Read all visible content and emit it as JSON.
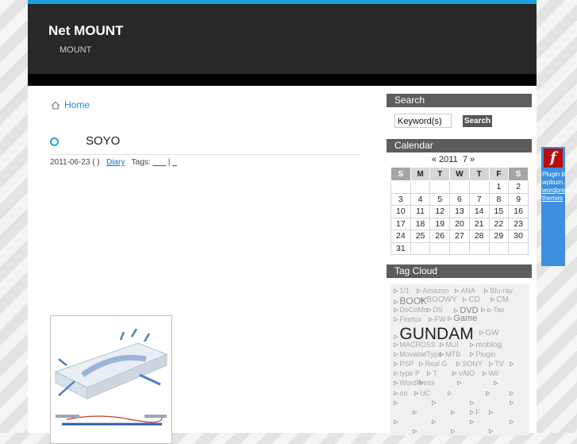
{
  "site": {
    "title": "Net MOUNT",
    "subtitle": "MOUNT"
  },
  "nav": {
    "home_label": "Home"
  },
  "post": {
    "title": "SOYO",
    "date": "2011-06-23 ( )",
    "category": "Diary",
    "tags_label": "Tags:",
    "tag1": "___",
    "tag_sep": " | ",
    "tag2": "_"
  },
  "search": {
    "heading": "Search",
    "value": "Keyword(s)",
    "button": "Search"
  },
  "calendar": {
    "heading": "Calendar",
    "prev": "«",
    "year": "2011",
    "month": "7",
    "next": "»",
    "weekdays": [
      "S",
      "M",
      "T",
      "W",
      "T",
      "F",
      "S"
    ],
    "weeks": [
      [
        "",
        "",
        "",
        "",
        "",
        "1",
        "2"
      ],
      [
        "3",
        "4",
        "5",
        "6",
        "7",
        "8",
        "9"
      ],
      [
        "10",
        "11",
        "12",
        "13",
        "14",
        "15",
        "16"
      ],
      [
        "17",
        "18",
        "19",
        "20",
        "21",
        "22",
        "23"
      ],
      [
        "24",
        "25",
        "26",
        "27",
        "28",
        "29",
        "30"
      ],
      [
        "31",
        "",
        "",
        "",
        "",
        "",
        ""
      ]
    ]
  },
  "tagcloud": {
    "heading": "Tag Cloud",
    "tags": [
      "1/1",
      "Amazon",
      "ANA",
      "Blu-ray",
      "BOOK",
      "BOOWY",
      "CD",
      "CM",
      "DoCoMo",
      "DS",
      "DVD",
      "e-Tax",
      "Firefox",
      "FW",
      "Game",
      "GUNDAM",
      "GW",
      "MACROSS",
      "MUI",
      "moblog",
      "MovableType",
      "MTB",
      "Plugin",
      "PSP",
      "Real G",
      "SONY",
      "TV",
      "type P",
      "T",
      "VAIO",
      "Wii",
      "WordPress",
      "oo",
      "UC",
      "F"
    ]
  },
  "flash": {
    "icon": "f",
    "line1": "Plugin by",
    "line2": "wpburn.com",
    "line3": "wordpress",
    "line4": "themes"
  },
  "colors": {
    "accent": "#1aa3e0",
    "header_bg": "#282828",
    "sidebar_heading": "#5d5d5d"
  }
}
